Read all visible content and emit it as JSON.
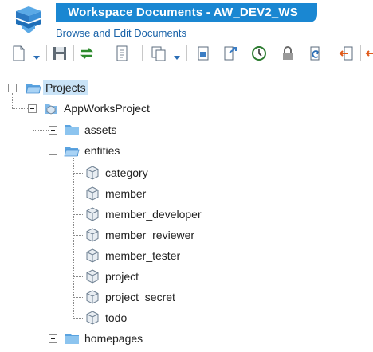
{
  "header": {
    "title": "Workspace Documents - AW_DEV2_WS",
    "subtitle": "Browse and Edit Documents"
  },
  "toolbar": {
    "buttons": [
      "new-document-icon",
      "save-icon",
      "synchronize-icon",
      "properties-icon",
      "copy-icon",
      "import-icon",
      "export-icon",
      "history-icon",
      "lock-icon",
      "undo-icon",
      "move-icon",
      "exit-icon"
    ]
  },
  "tree": {
    "root": {
      "label": "Projects",
      "expanded": true,
      "selected": true
    },
    "project": {
      "label": "AppWorksProject",
      "expanded": true
    },
    "folders": {
      "assets": {
        "label": "assets",
        "expanded": false
      },
      "entities": {
        "label": "entities",
        "expanded": true
      },
      "homepages": {
        "label": "homepages",
        "expanded": false
      }
    },
    "entities": [
      "category",
      "member",
      "member_developer",
      "member_reviewer",
      "member_tester",
      "project",
      "project_secret",
      "todo"
    ]
  },
  "colors": {
    "title_bar": "#1a87d2",
    "subtitle_text": "#1862a8",
    "selection": "#c9e3f7",
    "folder": "#8cc4ef"
  }
}
